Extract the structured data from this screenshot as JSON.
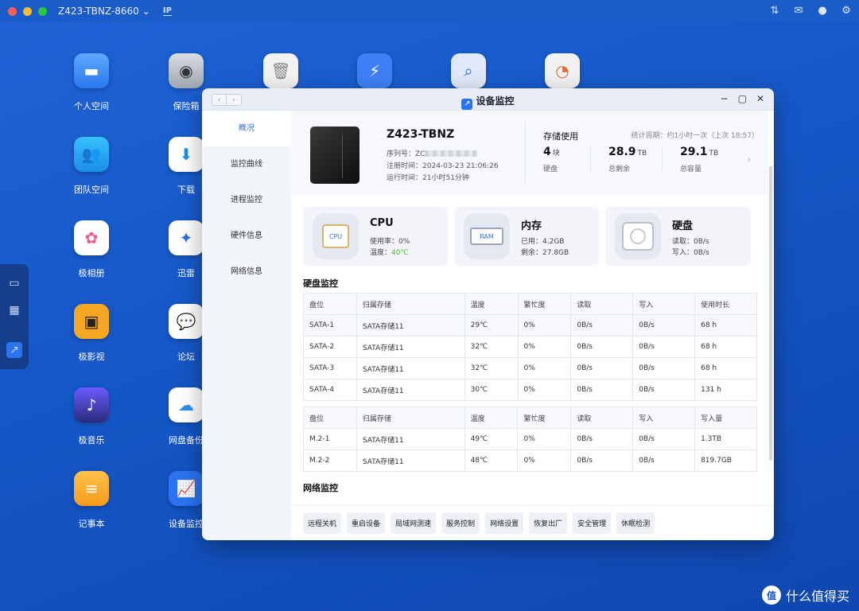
{
  "topbar": {
    "hostname": "Z423-TBNZ-8660",
    "ip_label": "IP"
  },
  "desktop": {
    "icons": [
      {
        "label": "个人空间",
        "icon": "folder-icon"
      },
      {
        "label": "保险箱",
        "icon": "safe-icon"
      },
      {
        "label": "",
        "icon": "trash-icon"
      },
      {
        "label": "",
        "icon": "thunder-app-icon"
      },
      {
        "label": "",
        "icon": "search-app-icon"
      },
      {
        "label": "",
        "icon": "database-app-icon"
      },
      {
        "label": "团队空间",
        "icon": "team-folder-icon"
      },
      {
        "label": "下载",
        "icon": "download-icon"
      },
      {
        "label": "极相册",
        "icon": "photos-icon"
      },
      {
        "label": "迅雷",
        "icon": "xunlei-icon"
      },
      {
        "label": "极影视",
        "icon": "video-icon"
      },
      {
        "label": "论坛",
        "icon": "forum-icon"
      },
      {
        "label": "极音乐",
        "icon": "music-icon"
      },
      {
        "label": "网盘备份",
        "icon": "cloud-backup-icon"
      },
      {
        "label": "记事本",
        "icon": "notepad-icon"
      },
      {
        "label": "设备监控",
        "icon": "monitor-icon"
      }
    ]
  },
  "window": {
    "title": "设备监控",
    "sidebar": [
      "概况",
      "监控曲线",
      "进程监控",
      "硬件信息",
      "网络信息"
    ]
  },
  "device": {
    "name": "Z423-TBNZ",
    "serial_label": "序列号：",
    "serial_value": "ZC",
    "reg_label": "注册时间：",
    "reg_value": "2024-03-23 21:06:26",
    "uptime_label": "运行时间：",
    "uptime_value": "21小时51分钟"
  },
  "storage": {
    "title": "存储使用",
    "note": "统计周期：约1小时一次（上次 18:57）",
    "disks_value": "4",
    "disks_unit": "块",
    "disks_label": "硬盘",
    "free_value": "28.9",
    "free_unit": "TB",
    "free_label": "总剩余",
    "total_value": "29.1",
    "total_unit": "TB",
    "total_label": "总容量"
  },
  "cards": {
    "cpu": {
      "title": "CPU",
      "chip": "CPU",
      "line1": "使用率：0%",
      "temp_label": "温度：",
      "temp_value": "40℃"
    },
    "mem": {
      "title": "内存",
      "chip": "RAM",
      "line1": "已用：4.2GB",
      "line2": "剩余：27.8GB"
    },
    "disk": {
      "title": "硬盘",
      "line1": "读取：0B/s",
      "line2": "写入：0B/s"
    }
  },
  "disk_monitor": {
    "title": "硬盘监控",
    "sata_headers": [
      "盘位",
      "归属存储",
      "温度",
      "繁忙度",
      "读取",
      "写入",
      "使用时长"
    ],
    "sata_rows": [
      [
        "SATA-1",
        "SATA存储11",
        "29℃",
        "0%",
        "0B/s",
        "0B/s",
        "68 h"
      ],
      [
        "SATA-2",
        "SATA存储11",
        "32℃",
        "0%",
        "0B/s",
        "0B/s",
        "68 h"
      ],
      [
        "SATA-3",
        "SATA存储11",
        "32℃",
        "0%",
        "0B/s",
        "0B/s",
        "68 h"
      ],
      [
        "SATA-4",
        "SATA存储11",
        "30℃",
        "0%",
        "0B/s",
        "0B/s",
        "131 h"
      ]
    ],
    "m2_headers": [
      "盘位",
      "归属存储",
      "温度",
      "繁忙度",
      "读取",
      "写入",
      "写入量"
    ],
    "m2_rows": [
      [
        "M.2-1",
        "SATA存储11",
        "49℃",
        "0%",
        "0B/s",
        "0B/s",
        "1.3TB"
      ],
      [
        "M.2-2",
        "SATA存储11",
        "48℃",
        "0%",
        "0B/s",
        "0B/s",
        "819.7GB"
      ]
    ]
  },
  "network_monitor": {
    "title": "网络监控"
  },
  "actions": [
    "远程关机",
    "重启设备",
    "局域网测速",
    "服务控制",
    "网络设置",
    "恢复出厂",
    "安全管理",
    "休眠检测"
  ],
  "watermark": {
    "text": "什么值得买",
    "glyph": "值"
  },
  "colors": {
    "accent": "#2b6ce8",
    "temp_ok": "#47b52b",
    "desktop_bg": "#1557c7"
  }
}
